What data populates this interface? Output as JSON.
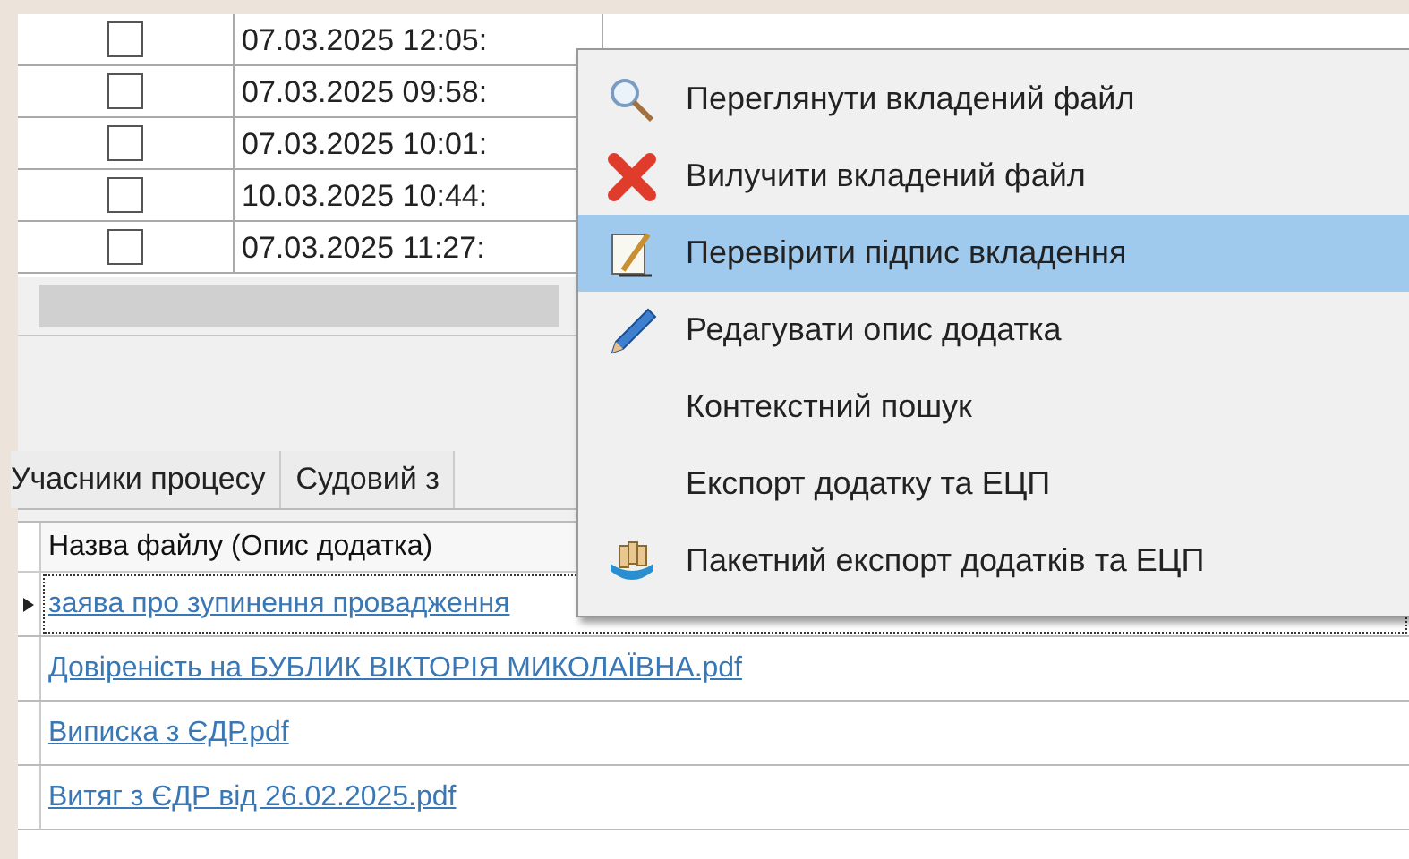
{
  "top_grid": {
    "rows": [
      {
        "checked": false,
        "date": "07.03.2025 12:05:"
      },
      {
        "checked": false,
        "date": "07.03.2025 09:58:"
      },
      {
        "checked": false,
        "date": "07.03.2025 10:01:"
      },
      {
        "checked": false,
        "date": "10.03.2025 10:44:"
      },
      {
        "checked": false,
        "date": "07.03.2025 11:27:"
      }
    ]
  },
  "tabs": [
    {
      "label": "Учасники процесу",
      "selected": false
    },
    {
      "label": "Судовий з",
      "selected": false
    }
  ],
  "attachments": {
    "header": "Назва файлу (Опис додатка)",
    "rows": [
      {
        "name": "заява про зупинення провадження",
        "selected": true
      },
      {
        "name": "Довіреність на БУБЛИК ВІКТОРІЯ МИКОЛАЇВНА.pdf",
        "selected": false
      },
      {
        "name": "Виписка з ЄДР.pdf",
        "selected": false
      },
      {
        "name": "Витяг з ЄДР від 26.02.2025.pdf",
        "selected": false
      }
    ]
  },
  "context_menu": {
    "items": [
      {
        "label": "Переглянути вкладений файл",
        "kind": "view",
        "selected": false
      },
      {
        "label": "Вилучити вкладений файл",
        "kind": "remove",
        "selected": false
      },
      {
        "label": "Перевірити підпис вкладення",
        "kind": "verify",
        "selected": true
      },
      {
        "label": "Редагувати опис додатка",
        "kind": "edit",
        "selected": false
      },
      {
        "label": "Контекстний пошук",
        "kind": "plain",
        "selected": false
      },
      {
        "label": "Експорт додатку та ЕЦП",
        "kind": "plain",
        "selected": false
      },
      {
        "label": "Пакетний експорт додатків та ЕЦП",
        "kind": "batch",
        "selected": false
      }
    ]
  }
}
